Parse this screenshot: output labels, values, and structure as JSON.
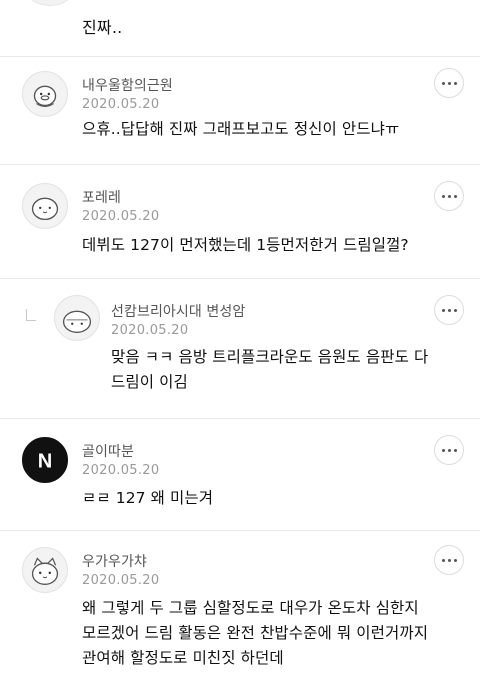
{
  "top_fragment": {
    "text": "진짜.."
  },
  "comments": [
    {
      "name": "내우울함의근원",
      "date": "2020.05.20",
      "lines": [
        "으휴..답답해 진짜 그래프보고도 정신이 안드냐ㅠ"
      ],
      "avatar_icon": "duck-avatar-icon"
    },
    {
      "name": "포레레",
      "date": "2020.05.20",
      "lines": [
        "데뷔도 127이 먼저했는데 1등먼저한거 드림일껄?"
      ],
      "avatar_icon": "bunny-avatar-icon"
    },
    {
      "name": "선캄브리아시대 변성암",
      "date": "2020.05.20",
      "lines": [
        "맞음 ㅋㅋ 음방 트리플크라운도 음원도 음판도 다",
        "드림이 이김"
      ],
      "avatar_icon": "rock-avatar-icon",
      "is_reply": true
    },
    {
      "name": "골이따분",
      "date": "2020.05.20",
      "lines": [
        "ㄹㄹ 127 왜 미는겨"
      ],
      "avatar_icon": "letter-n-avatar-icon"
    },
    {
      "name": "우가우가챠",
      "date": "2020.05.20",
      "lines": [
        "왜 그렇게 두 그룹 심할정도로 대우가 온도차 심한지",
        "모르겠어 드림 활동은 완전 찬밥수준에 뭐 이런거까지",
        "관여해 할정도로 미친짓 하던데"
      ],
      "avatar_icon": "cat-avatar-icon"
    }
  ],
  "avatar_letter": "N",
  "colors": {
    "name": "#555555",
    "date": "#9a9a9a",
    "text": "#111111",
    "divider": "#e9e9e9"
  }
}
